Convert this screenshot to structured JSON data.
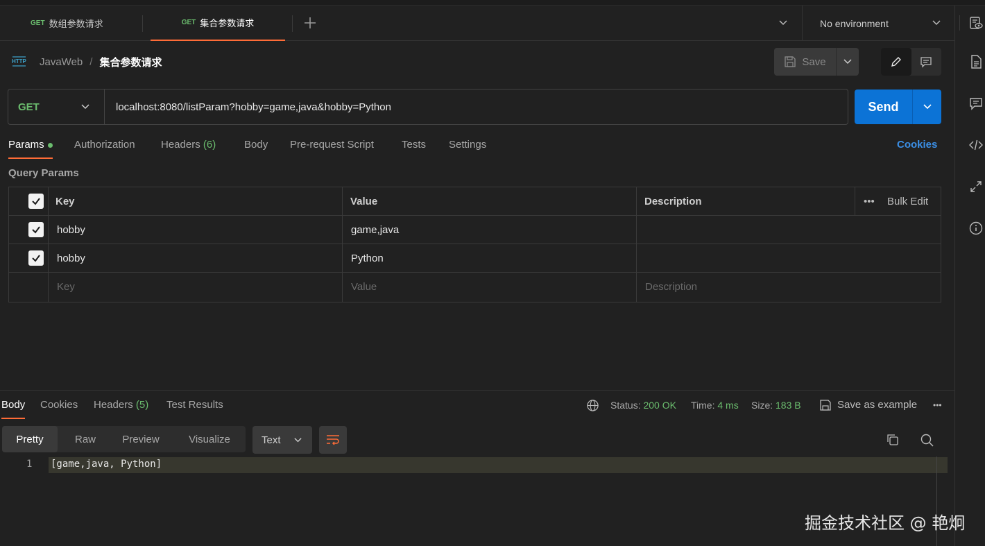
{
  "tabs": [
    {
      "method": "GET",
      "title": "数组参数请求"
    },
    {
      "method": "GET",
      "title": "集合参数请求"
    }
  ],
  "environment": "No environment",
  "breadcrumb": {
    "collection": "JavaWeb",
    "separator": "/",
    "request": "集合参数请求"
  },
  "toolbar": {
    "save_label": "Save"
  },
  "request": {
    "method": "GET",
    "url": "localhost:8080/listParam?hobby=game,java&hobby=Python",
    "send_label": "Send"
  },
  "request_tabs": {
    "params": "Params",
    "authorization": "Authorization",
    "headers": "Headers",
    "headers_count": "(6)",
    "body": "Body",
    "prerequest": "Pre-request Script",
    "tests": "Tests",
    "settings": "Settings",
    "cookies": "Cookies"
  },
  "query_params": {
    "title": "Query Params",
    "headers": {
      "key": "Key",
      "value": "Value",
      "description": "Description",
      "bulk_edit": "Bulk Edit"
    },
    "rows": [
      {
        "checked": true,
        "key": "hobby",
        "value": "game,java",
        "description": ""
      },
      {
        "checked": true,
        "key": "hobby",
        "value": "Python",
        "description": ""
      }
    ],
    "placeholders": {
      "key": "Key",
      "value": "Value",
      "description": "Description"
    }
  },
  "response": {
    "tabs": {
      "body": "Body",
      "cookies": "Cookies",
      "headers": "Headers",
      "headers_count": "(5)",
      "test_results": "Test Results"
    },
    "status_label": "Status:",
    "status_value": "200 OK",
    "time_label": "Time:",
    "time_value": "4 ms",
    "size_label": "Size:",
    "size_value": "183 B",
    "save_example": "Save as example",
    "views": {
      "pretty": "Pretty",
      "raw": "Raw",
      "preview": "Preview",
      "visualize": "Visualize"
    },
    "format": "Text",
    "lines": [
      {
        "number": "1",
        "text": "[game,java, Python]"
      }
    ]
  },
  "watermark": "掘金技术社区 @ 艳炯",
  "colors": {
    "accent": "#ff6c37",
    "send": "#0c73d6",
    "method_get": "#6bbd6e",
    "link": "#3b8fe6"
  }
}
